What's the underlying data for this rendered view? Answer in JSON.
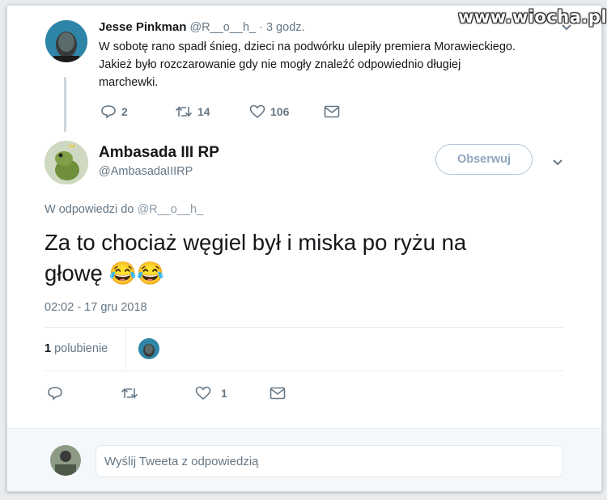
{
  "parent_tweet": {
    "author_name": "Jesse Pinkman",
    "handle": "@R__o__h_",
    "time": "· 3 godz.",
    "text_lines": [
      "W sobotę rano spadł śnieg, dzieci na podwórku ulepiły premiera Morawieckiego.",
      "Jakież było rozczarowanie gdy nie mogły znaleźć odpowiednio długiej",
      "marchewki."
    ],
    "replies": "2",
    "retweets": "14",
    "likes": "106"
  },
  "main_tweet": {
    "author_name": "Ambasada III RP",
    "handle": "@AmbasadaIIIRP",
    "follow_label": "Obserwuj",
    "reply_to_prefix": "W odpowiedzi do",
    "reply_to_handle": "@R__o__h_",
    "text_line1": "Za to chociaż węgiel był i miska po ryżu na",
    "text_line2": "głowę 😂😂",
    "timestamp": "02:02 - 17 gru 2018",
    "like_count_num": "1",
    "like_count_label": "polubienie",
    "likes": "1"
  },
  "reply_box": {
    "placeholder": "Wyślij Tweeta z odpowiedzią"
  },
  "watermark": "www.wiocha.pl",
  "colors": {
    "icon": "#657786",
    "border": "#e6ecf0",
    "follow_text": "#8fa6bd"
  }
}
